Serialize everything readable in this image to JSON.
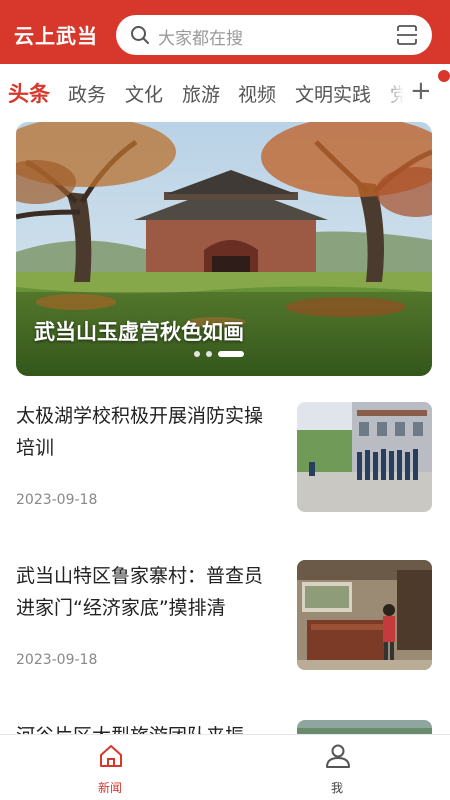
{
  "header": {
    "app_title": "云上武当",
    "search_placeholder": "大家都在搜"
  },
  "tabs": [
    "头条",
    "政务",
    "文化",
    "旅游",
    "视频",
    "文明实践",
    "党"
  ],
  "banner": {
    "title": "武当山玉虚宫秋色如画",
    "slide_count": 3,
    "active_slide": 3
  },
  "news": [
    {
      "title": "太极湖学校积极开展消防实操培训",
      "date": "2023-09-18"
    },
    {
      "title": "武当山特区鲁家寨村：普查员进家门“经济家底”摸排清",
      "date": "2023-09-18"
    },
    {
      "title": "河谷片区大型旅游团队来振",
      "date": ""
    }
  ],
  "bottom_nav": [
    {
      "label": "新闻",
      "icon": "home-icon",
      "active": true
    },
    {
      "label": "我",
      "icon": "user-icon",
      "active": false
    }
  ],
  "colors": {
    "accent": "#d8382b",
    "text": "#222222",
    "muted": "#888888"
  }
}
